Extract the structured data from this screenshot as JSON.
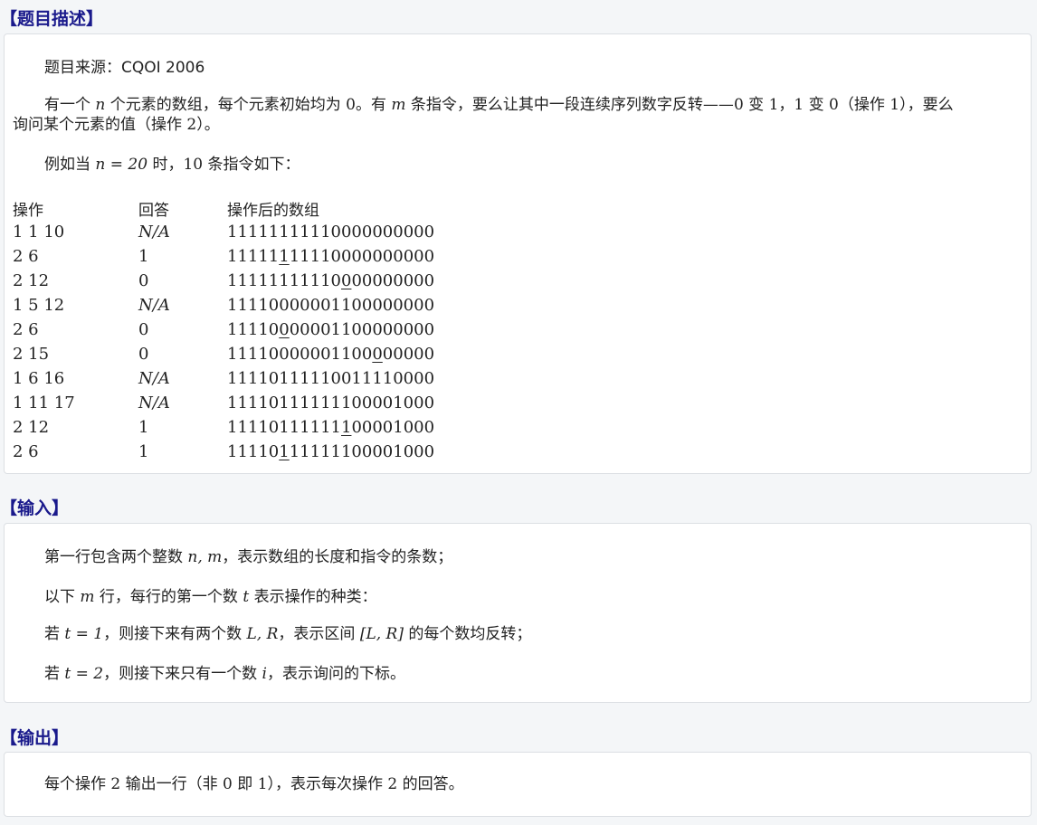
{
  "desc": {
    "title": "【题目描述】",
    "source": "题目来源：CQOI 2006",
    "p1": {
      "a": "有一个 ",
      "n": "n",
      "b": " 个元素的数组，每个元素初始均为 ",
      "zero": "0",
      "c": "。有 ",
      "m": "m",
      "d": " 条指令，要么让其中一段连续序列数字反转——",
      "z0": "0",
      "e": " 变 ",
      "o1": "1",
      "f": "，",
      "o2": "1",
      "g": " 变 ",
      "z1": "0",
      "h": "（操作 ",
      "op1": "1",
      "i": "），要么",
      "line2": {
        "a": "询问某个元素的值（操作 ",
        "op2": "2",
        "b": "）。"
      }
    },
    "p2": {
      "a": "例如当 ",
      "expr": "n = 20",
      "b": " 时，",
      "ten": "10",
      "c": " 条指令如下："
    },
    "table": {
      "headers": [
        "操作",
        "回答",
        "操作后的数组"
      ],
      "rows": [
        {
          "op": "1 1 10",
          "ans": "N/A",
          "pre": "1111111111",
          "mark": "",
          "post": "0000000000"
        },
        {
          "op": "2 6",
          "ans": "1",
          "pre": "11111",
          "mark": "1",
          "post": "11110000000000"
        },
        {
          "op": "2 12",
          "ans": "0",
          "pre": "11111111110",
          "mark": "0",
          "post": "00000000"
        },
        {
          "op": "1 5 12",
          "ans": "N/A",
          "pre": "11110000001100000000",
          "mark": "",
          "post": ""
        },
        {
          "op": "2 6",
          "ans": "0",
          "pre": "11110",
          "mark": "0",
          "post": "00001100000000"
        },
        {
          "op": "2 15",
          "ans": "0",
          "pre": "11110000001100",
          "mark": "0",
          "post": "00000"
        },
        {
          "op": "1 6 16",
          "ans": "N/A",
          "pre": "11110111110011110000",
          "mark": "",
          "post": ""
        },
        {
          "op": "1 11 17",
          "ans": "N/A",
          "pre": "11110111111100001000",
          "mark": "",
          "post": ""
        },
        {
          "op": "2 12",
          "ans": "1",
          "pre": "11110111111",
          "mark": "1",
          "post": "00001000"
        },
        {
          "op": "2 6",
          "ans": "1",
          "pre": "11110",
          "mark": "1",
          "post": "11111100001000"
        }
      ]
    }
  },
  "input": {
    "title": "【输入】",
    "l1": {
      "a": "第一行包含两个整数 ",
      "nm": "n, m",
      "b": "，表示数组的长度和指令的条数；"
    },
    "l2": {
      "a": "以下 ",
      "m": "m",
      "b": " 行，每行的第一个数 ",
      "t": "t",
      "c": " 表示操作的种类："
    },
    "l3": {
      "a": "若 ",
      "t1": "t = 1",
      "b": "，则接下来有两个数 ",
      "LR": "L, R",
      "c": "，表示区间 ",
      "interval": "[L, R]",
      "d": " 的每个数均反转；"
    },
    "l4": {
      "a": "若 ",
      "t2": "t = 2",
      "b": "，则接下来只有一个数 ",
      "i": "i",
      "c": "，表示询问的下标。"
    }
  },
  "output": {
    "title": "【输出】",
    "l1": {
      "a": "每个操作 ",
      "two": "2",
      "b": " 输出一行（非 ",
      "zero": "0",
      "c": " 即 ",
      "one": "1",
      "d": "），表示每次操作 ",
      "two2": "2",
      "e": " 的回答。"
    }
  }
}
